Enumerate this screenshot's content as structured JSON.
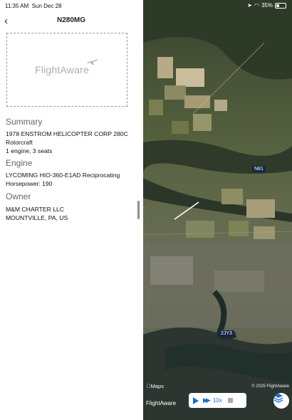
{
  "status_bar": {
    "time": "11:35 AM",
    "date": "Sun Dec 28",
    "battery": "35%",
    "battery_level": 0.35
  },
  "nav": {
    "title": "N280MG"
  },
  "photo": {
    "logo_text": "FlightAware"
  },
  "summary": {
    "heading": "Summary",
    "lines": [
      "1978 ENSTROM HELICOPTER CORP 280C",
      "Rotorcraft",
      "1 engine, 3 seats"
    ]
  },
  "engine": {
    "heading": "Engine",
    "lines": [
      "LYCOMING HIO-360-E1AD Reciprocating",
      "Horsepower:  190"
    ]
  },
  "owner": {
    "heading": "Owner",
    "lines": [
      "M&M CHARTER LLC",
      "MOUNTVILLE, PA, US"
    ]
  },
  "map": {
    "airport_badges": [
      "N81",
      "2JY3"
    ],
    "maps_label": "Maps",
    "copyright": "© 2025 FlightAware",
    "flightaware_label": "FlightAware",
    "playback_speed": "10x",
    "accent_color": "#1b6fc9"
  }
}
